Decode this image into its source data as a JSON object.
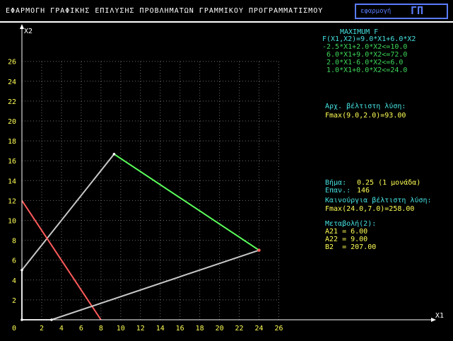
{
  "window": {
    "title": "ΕΦΑΡΜΟΓΗ ΓΡΑΦΙΚΗΣ ΕΠΙΛΥΣΗΣ ΠΡΟΒΛΗΜΑΤΩΝ ΓΡΑΜΜΙΚΟΥ ΠΡΟΓΡΑΜΜΑΤΙΣΜΟΥ",
    "logo_small": "εφαρμογή",
    "logo_big": "ΓΠ"
  },
  "problem": {
    "heading": "MAXIMUM F",
    "objective": "F(X1,X2)=9.0*X1+6.0*X2",
    "constraints": [
      "-2.5*X1+2.0*X2<=10.0",
      " 6.0*X1+9.0*X2<=72.0",
      " 2.0*X1-6.0*X2<=6.0",
      " 1.0*X1+0.0*X2<=24.0"
    ]
  },
  "solution": {
    "heading": "Αρχ. βέλτιστη λύση:",
    "value": "Fmax(9.0,2.0)=93.00"
  },
  "sensitivity": {
    "step_label": "Βήμα:",
    "step_value": "0.25 (1 μονάδα)",
    "iter_label": "Επαν.:",
    "iter_value": "146",
    "new_heading": "Καινούργια βέλτιστη λύση:",
    "new_value": "Fmax(24.0,7.0)=258.00",
    "changes_heading": "Μεταβολή(2):",
    "a21": "A21 = 6.00",
    "a22": "A22 = 9.00",
    "b2": "B2  = 207.00"
  },
  "chart_data": {
    "type": "line",
    "xlabel": "X1",
    "ylabel": "X2",
    "xlim": [
      0,
      26
    ],
    "ylim": [
      0,
      26
    ],
    "x_ticks": [
      "0",
      "2",
      "4",
      "6",
      "8",
      "10",
      "12",
      "14",
      "16",
      "18",
      "20",
      "22",
      "24",
      "26"
    ],
    "y_ticks": [
      "2",
      "4",
      "6",
      "8",
      "10",
      "12",
      "14",
      "16",
      "18",
      "20",
      "22",
      "24",
      "26"
    ],
    "grid": true,
    "segments": [
      {
        "color": "#c8c8c8",
        "points": [
          [
            0,
            0
          ],
          [
            0,
            5
          ]
        ]
      },
      {
        "color": "#c8c8c8",
        "points": [
          [
            0,
            5
          ],
          [
            9.33,
            16.67
          ]
        ]
      },
      {
        "color": "#ff5a5a",
        "points": [
          [
            0,
            12
          ],
          [
            8,
            0
          ]
        ]
      },
      {
        "color": "#5aff5a",
        "points": [
          [
            9.33,
            16.67
          ],
          [
            24,
            7
          ]
        ]
      },
      {
        "color": "#c8c8c8",
        "points": [
          [
            3,
            0
          ],
          [
            24,
            7
          ]
        ]
      },
      {
        "color": "#c8c8c8",
        "points": [
          [
            0,
            0
          ],
          [
            3,
            0
          ]
        ]
      }
    ],
    "vertices": [
      [
        0,
        0
      ],
      [
        0,
        5
      ],
      [
        9.33,
        16.67
      ],
      [
        24,
        7
      ],
      [
        3,
        0
      ]
    ],
    "highlight": [
      24,
      7
    ]
  },
  "colors": {
    "axis": "#ffffff",
    "grid": "#6a6a6a",
    "tick_text": "#ffff55",
    "header": "#46e0e0",
    "constraint": "#3dd65a",
    "result": "#ffff55"
  }
}
